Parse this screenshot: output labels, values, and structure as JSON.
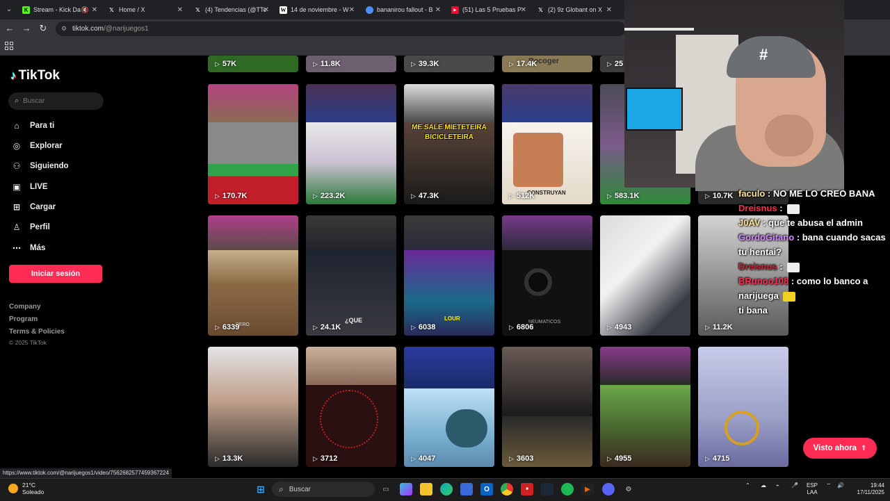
{
  "browser": {
    "tabs": [
      {
        "label": "Stream - Kick Da",
        "icon": "kick-icon",
        "color": "#53fc18"
      },
      {
        "label": "Home / X",
        "icon": "x-icon",
        "color": "#000000"
      },
      {
        "label": "(4) Tendencias (@TTe",
        "icon": "x-icon",
        "color": "#000000"
      },
      {
        "label": "14 de noviembre - W",
        "icon": "wikipedia-icon",
        "color": "#ffffff"
      },
      {
        "label": "bananirou fallout - B",
        "icon": "search-engine-icon",
        "color": "#4f8df7"
      },
      {
        "label": "(51) Las 5 Pruebas P",
        "icon": "youtube-icon",
        "color": "#ff0033"
      },
      {
        "label": "(2) 9z Globant on X",
        "icon": "x-icon",
        "color": "#000000"
      }
    ],
    "url_domain": "tiktok.com",
    "url_path": "/@narijuegos1",
    "status_url": "https://www.tiktok.com/@narijuegos1/video/7562682577459367224"
  },
  "sidebar": {
    "logo": "TikTok",
    "search_placeholder": "Buscar",
    "nav": [
      {
        "label": "Para ti",
        "icon": "home-icon"
      },
      {
        "label": "Explorar",
        "icon": "compass-icon"
      },
      {
        "label": "Siguiendo",
        "icon": "following-icon"
      },
      {
        "label": "LIVE",
        "icon": "live-icon"
      },
      {
        "label": "Cargar",
        "icon": "upload-icon"
      },
      {
        "label": "Perfil",
        "icon": "profile-icon"
      },
      {
        "label": "Más",
        "icon": "more-icon"
      }
    ],
    "login_label": "Iniciar sesión",
    "footer": [
      "Company",
      "Program",
      "Terms & Policies"
    ],
    "copyright": "© 2025 TikTok"
  },
  "videos": {
    "row0": [
      "57K",
      "11.8K",
      "39.3K",
      "17.4K",
      "25"
    ],
    "row1": [
      "170.7K",
      "223.2K",
      "47.3K",
      "512K",
      "583.1K",
      "10.7K"
    ],
    "row2": [
      "6339",
      "24.1K",
      "6038",
      "6806",
      "4943",
      "11.2K"
    ],
    "row3": [
      "13.3K",
      "3712",
      "4047",
      "3603",
      "4955",
      "4715"
    ],
    "overlay_texts": {
      "row0_card3": "Recoger",
      "row1_card2_a": "ME SALE MIETETEIRA",
      "row1_card2_b": "BICICLETEIRA",
      "row1_card3": "CONSTRUYAN",
      "row2_card0": "PERO",
      "row2_card1": "¿QUE",
      "row2_card2": "LOUR",
      "row2_card3": "NEUMATICOS"
    }
  },
  "chat": [
    {
      "user": "faculo",
      "text": "NO ME LO CREO BANA",
      "color": "#ffe49a"
    },
    {
      "user": "Dreisnus",
      "text": "",
      "emote": true,
      "color": "#ff2e4f"
    },
    {
      "user": "J0AV",
      "text": "que te abusa el admin",
      "color": "#ffe49a"
    },
    {
      "user": "GordoGitano",
      "text": "bana cuando sacas tu hentai?",
      "color": "#d08bff"
    },
    {
      "user": "Dreisnus",
      "text": "",
      "emote": true,
      "color": "#c62138"
    },
    {
      "user": "BRunoo108",
      "text": "como lo banco a narijuega",
      "color": "#ff2e4f"
    },
    {
      "user": "",
      "text": "ti bana",
      "color": "#ffffff"
    }
  ],
  "visto_ahora": "Visto ahora",
  "taskbar": {
    "temperature": "21°C",
    "weather": "Soleado",
    "search_placeholder": "Buscar",
    "language": "ESP",
    "layout": "LAA",
    "time": "19:44",
    "date": "17/11/2025"
  }
}
